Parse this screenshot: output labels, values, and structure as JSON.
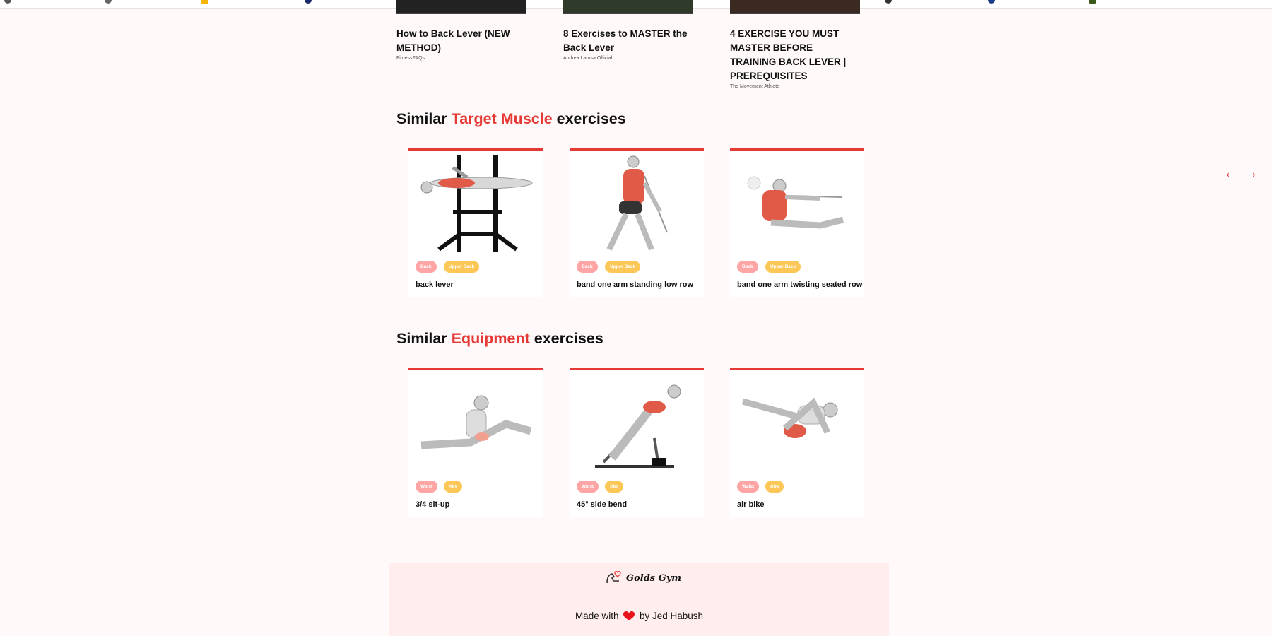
{
  "videos": [
    {
      "title": "How to Back Lever (NEW METHOD)",
      "channel": "FitnessFAQs"
    },
    {
      "title": "8 Exercises to MASTER the Back Lever",
      "channel": "Andrea Larosa Official"
    },
    {
      "title": "4 EXERCISE YOU MUST MASTER BEFORE TRAINING BACK LEVER | PREREQUISITES",
      "channel": "The Movement Athlete"
    }
  ],
  "target_section": {
    "prefix": "Similar ",
    "highlight": "Target Muscle",
    "suffix": " exercises"
  },
  "equipment_section": {
    "prefix": "Similar ",
    "highlight": "Equipment",
    "suffix": " exercises"
  },
  "target_cards": [
    {
      "name": "back lever",
      "badge1": "Back",
      "badge2": "Upper Back"
    },
    {
      "name": "band one arm standing low row",
      "badge1": "Back",
      "badge2": "Upper Back"
    },
    {
      "name": "band one arm twisting seated row",
      "badge1": "Back",
      "badge2": "Upper Back"
    }
  ],
  "equipment_cards": [
    {
      "name": "3/4 sit-up",
      "badge1": "Waist",
      "badge2": "Abs"
    },
    {
      "name": "45° side bend",
      "badge1": "Waist",
      "badge2": "Abs"
    },
    {
      "name": "air bike",
      "badge1": "Waist",
      "badge2": "Abs"
    }
  ],
  "nav": {
    "prev": "←",
    "next": "→"
  },
  "footer": {
    "brand": "Golds Gym",
    "made_with": "Made with",
    "by": "by Jed Habush"
  },
  "colors": {
    "accent": "#e53935",
    "badge_primary": "#ffa5a5",
    "badge_secondary": "#fcc757",
    "background": "#fff9f9",
    "footer_bg": "#ffeeed"
  }
}
